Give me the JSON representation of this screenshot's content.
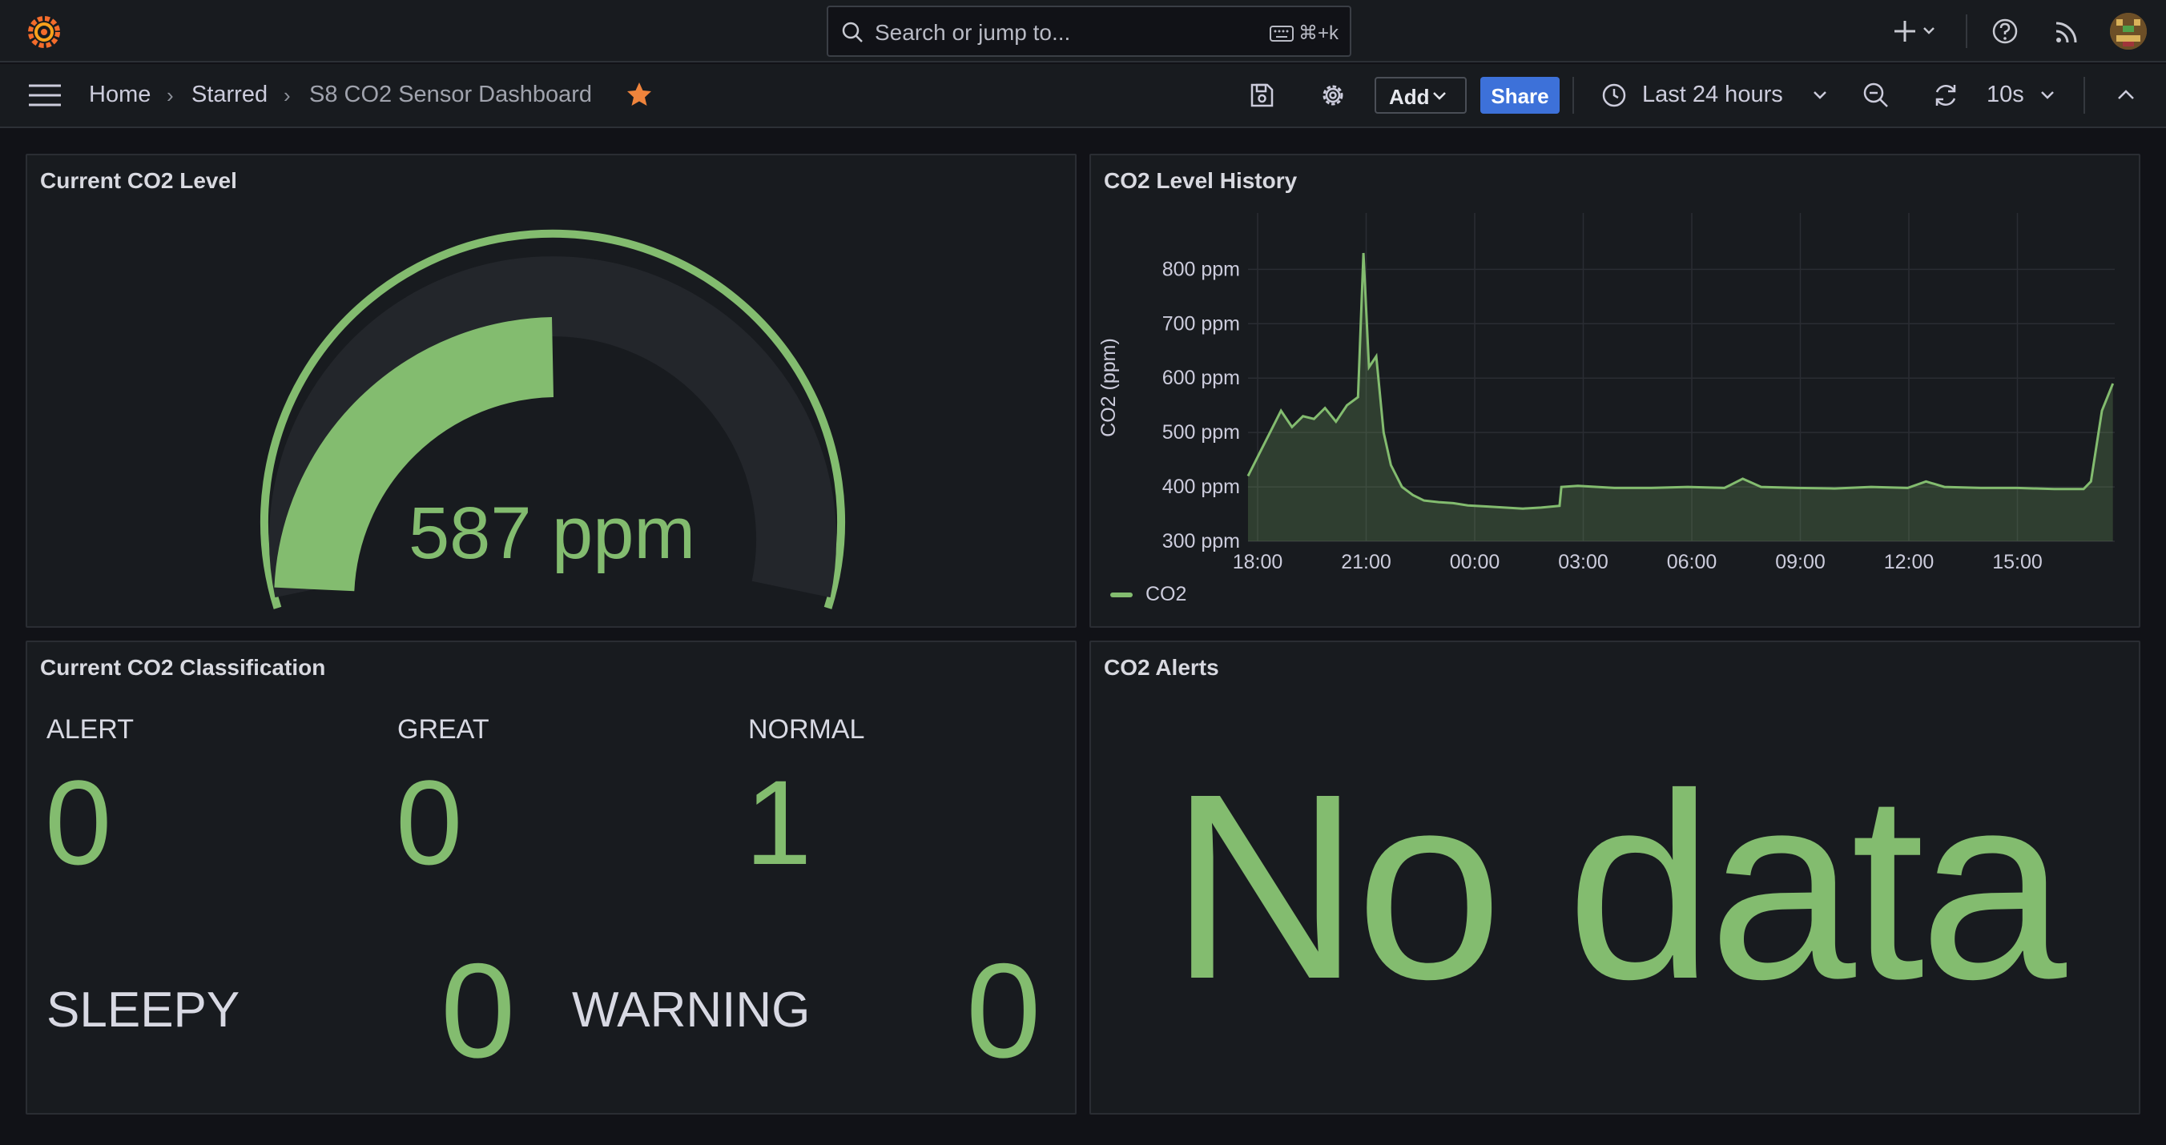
{
  "topbar": {
    "search_placeholder": "Search or jump to...",
    "search_shortcut": "⌘+k"
  },
  "breadcrumb": {
    "home": "Home",
    "starred": "Starred",
    "dashboard": "S8 CO2 Sensor Dashboard"
  },
  "toolbar": {
    "add_label": "Add",
    "share_label": "Share",
    "time_range": "Last 24 hours",
    "refresh_interval": "10s"
  },
  "colors": {
    "accent_green": "#83bc6f",
    "share_blue": "#3d71d9",
    "star_orange": "#ef843c"
  },
  "panels": {
    "gauge": {
      "title": "Current CO2 Level",
      "value_text": "587 ppm",
      "fraction": 0.5
    },
    "history": {
      "title": "CO2 Level History",
      "legend": "CO2"
    },
    "classification": {
      "title": "Current CO2 Classification",
      "items": [
        {
          "label": "ALERT",
          "value": "0"
        },
        {
          "label": "GREAT",
          "value": "0"
        },
        {
          "label": "NORMAL",
          "value": "1"
        },
        {
          "label": "SLEEPY",
          "value": "0"
        },
        {
          "label": "WARNING",
          "value": "0"
        }
      ]
    },
    "alerts": {
      "title": "CO2 Alerts",
      "no_data": "No data"
    }
  },
  "chart_data": {
    "type": "area",
    "ylabel": "CO2 (ppm)",
    "ylim": [
      300,
      880
    ],
    "y_ticks": [
      "300 ppm",
      "400 ppm",
      "500 ppm",
      "600 ppm",
      "700 ppm",
      "800 ppm"
    ],
    "x_ticks": [
      "18:00",
      "21:00",
      "00:00",
      "03:00",
      "06:00",
      "09:00",
      "12:00",
      "15:00"
    ],
    "grid": true,
    "legend_position": "bottom-left",
    "series": [
      {
        "name": "CO2",
        "x_hours": [
          0,
          0.3,
          0.6,
          0.9,
          1.2,
          1.5,
          1.8,
          2.1,
          2.4,
          2.7,
          3.0,
          3.15,
          3.3,
          3.5,
          3.7,
          3.9,
          4.2,
          4.5,
          4.8,
          5.2,
          5.6,
          6.0,
          6.5,
          7.0,
          7.5,
          8.0,
          8.5,
          8.55,
          9.0,
          10.0,
          11.0,
          12.0,
          13.0,
          13.5,
          14.0,
          15.0,
          16.0,
          17.0,
          18.0,
          18.5,
          19.0,
          20.0,
          21.0,
          22.0,
          22.8,
          23.0,
          23.3,
          23.6
        ],
        "values": [
          420,
          460,
          500,
          540,
          510,
          530,
          525,
          545,
          520,
          550,
          565,
          830,
          620,
          640,
          500,
          440,
          400,
          385,
          375,
          372,
          370,
          366,
          364,
          362,
          360,
          362,
          365,
          400,
          402,
          398,
          398,
          400,
          398,
          415,
          400,
          398,
          397,
          400,
          398,
          410,
          400,
          398,
          398,
          396,
          396,
          410,
          540,
          590
        ]
      }
    ]
  }
}
